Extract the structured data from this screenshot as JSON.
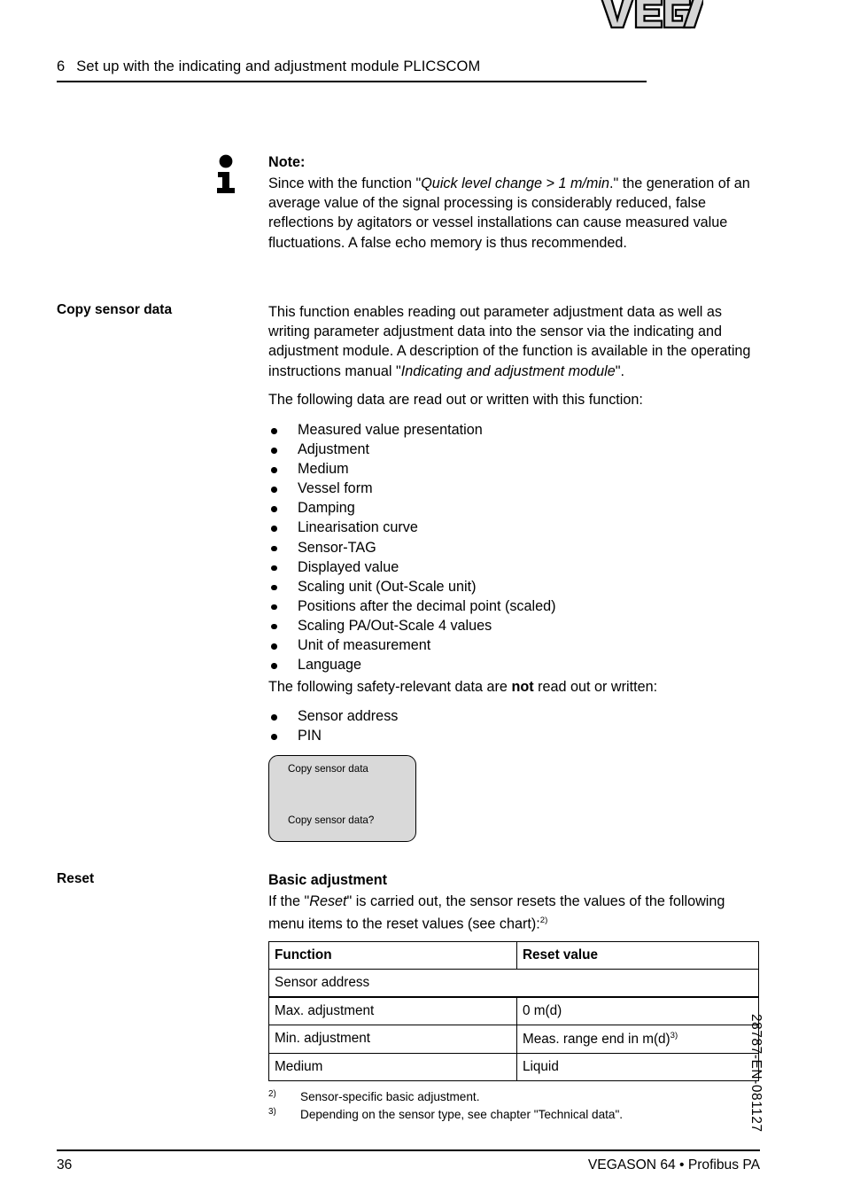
{
  "header": {
    "chapter_number": "6",
    "title": "Set up with the indicating and adjustment module PLICSCOM",
    "logo_text": "VEGA"
  },
  "note": {
    "icon": "info-icon",
    "title": "Note:",
    "body_part_1": "Since with the function \"",
    "body_italic": "Quick level change > 1 m/min",
    "body_part_2": ".\" the generation of an average value of the signal processing is considerably reduced, false reflections by agitators or vessel installations can cause measured value fluctuations. A false echo memory is thus recommended."
  },
  "copy_sensor_data": {
    "side_label": "Copy sensor data",
    "para_1_part_1": "This function enables reading out parameter adjustment data as well as writing parameter adjustment data into the sensor via the indicating and adjustment module. A description of the function is available in the operating instructions manual \"",
    "para_1_italic": "Indicating and adjustment module",
    "para_1_part_2": "\".",
    "para_2": "The following data are read out or written with this function:",
    "read_write_items": [
      "Measured value presentation",
      "Adjustment",
      "Medium",
      "Vessel form",
      "Damping",
      "Linearisation curve",
      "Sensor-TAG",
      "Displayed value",
      "Scaling unit (Out-Scale unit)",
      "Positions after the decimal point (scaled)",
      "Scaling PA/Out-Scale 4 values",
      "Unit of measurement",
      "Language"
    ],
    "para_3_part_1": "The following safety-relevant data are ",
    "para_3_bold": "not",
    "para_3_part_2": " read out or written:",
    "excluded_items": [
      "Sensor address",
      "PIN"
    ],
    "display_box": {
      "line_1": "Copy sensor data",
      "line_2": "Copy sensor data?",
      "fill_color": "#d9d9d9"
    }
  },
  "reset": {
    "side_label": "Reset",
    "heading": "Basic adjustment",
    "intro_part_1": "If the \"",
    "intro_italic": "Reset",
    "intro_part_2": "\" is carried out, the sensor resets the values of the following menu items to the reset values (see chart):",
    "intro_footnote_marker": "2)",
    "table": {
      "headers": [
        "Function",
        "Reset value"
      ],
      "rows": [
        {
          "function": "Sensor address",
          "reset_value": "",
          "full_span": true
        },
        {
          "function": "Max. adjustment",
          "reset_value": "0 m(d)",
          "full_span": false
        },
        {
          "function": "Min. adjustment",
          "reset_value": "Meas. range end in m(d)",
          "reset_value_footnote": "3)",
          "full_span": false
        },
        {
          "function": "Medium",
          "reset_value": "Liquid",
          "full_span": false
        }
      ]
    }
  },
  "footnotes": [
    {
      "marker": "2)",
      "text": "Sensor-specific basic adjustment."
    },
    {
      "marker": "3)",
      "text": "Depending on the sensor type, see chapter \"Technical data\"."
    }
  ],
  "footer": {
    "page_number": "36",
    "product": "VEGASON 64 • Profibus PA",
    "document_number": "28787-EN-081127"
  }
}
